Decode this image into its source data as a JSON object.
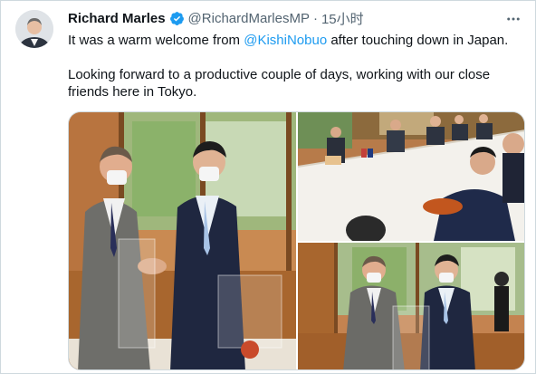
{
  "tweet": {
    "author_name": "Richard Marles",
    "author_handle": "@RichardMarlesMP",
    "separator": "·",
    "timestamp": "15小时",
    "text_line1_prefix": "It was a warm welcome from ",
    "mention": "@KishiNobuo",
    "text_line1_suffix": " after touching down in Japan.",
    "text_paragraph2": "Looking forward to a productive couple of days, working with our close friends here in Tokyo."
  },
  "icons": {
    "verified": "verified-badge-icon",
    "more": "more-options-icon"
  },
  "colors": {
    "accent": "#1d9bf0",
    "muted_text": "#536471",
    "primary_text": "#0f1419",
    "border": "#cfd9de"
  }
}
